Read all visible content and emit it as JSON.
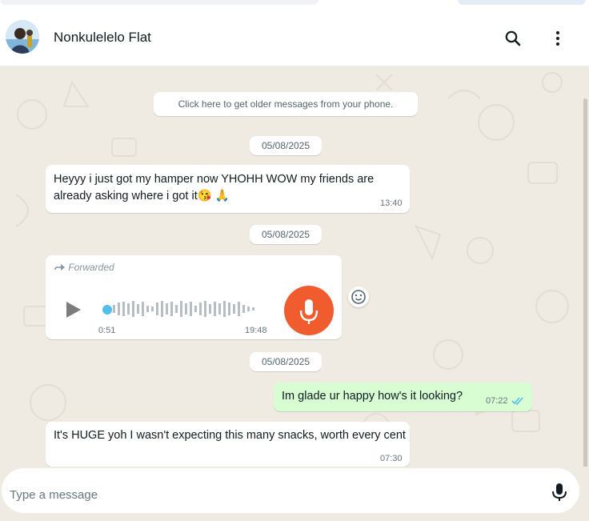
{
  "header": {
    "contact_name": "Nonkulelelo Flat",
    "icons": {
      "search": "search-icon",
      "menu": "more-vertical-icon",
      "avatar": "contact-avatar"
    }
  },
  "chat": {
    "older_messages_note": "Click here to get older messages from your phone.",
    "messages": [
      {
        "type": "date",
        "text": "05/08/2025"
      },
      {
        "type": "text",
        "direction": "incoming",
        "text": "Heyyy i just got my hamper now YHOHH WOW my friends are already asking where i got it",
        "emoji": "😘 🙏",
        "time": "13:40"
      },
      {
        "type": "date",
        "text": "05/08/2025"
      },
      {
        "type": "voice",
        "direction": "incoming",
        "forwarded_label": "Forwarded",
        "duration": "0:51",
        "time": "19:48",
        "react_icon": "emoji-icon"
      },
      {
        "type": "date",
        "text": "05/08/2025"
      },
      {
        "type": "text",
        "direction": "outgoing",
        "text": "Im glade ur happy how's it looking?",
        "time": "07:22",
        "status": "read"
      },
      {
        "type": "text",
        "direction": "incoming",
        "text": "It's HUGE yoh I wasn't expecting this many snacks, worth every cent",
        "time": "07:30"
      }
    ]
  },
  "composer": {
    "placeholder": "Type a message",
    "value": "",
    "mic_icon": "microphone-icon"
  },
  "colors": {
    "chat_bg": "#efeae2",
    "incoming_bubble": "#ffffff",
    "outgoing_bubble": "#d9fdd3",
    "read_ticks": "#53bdeb",
    "voice_mic_accent": "#f15c2e"
  }
}
